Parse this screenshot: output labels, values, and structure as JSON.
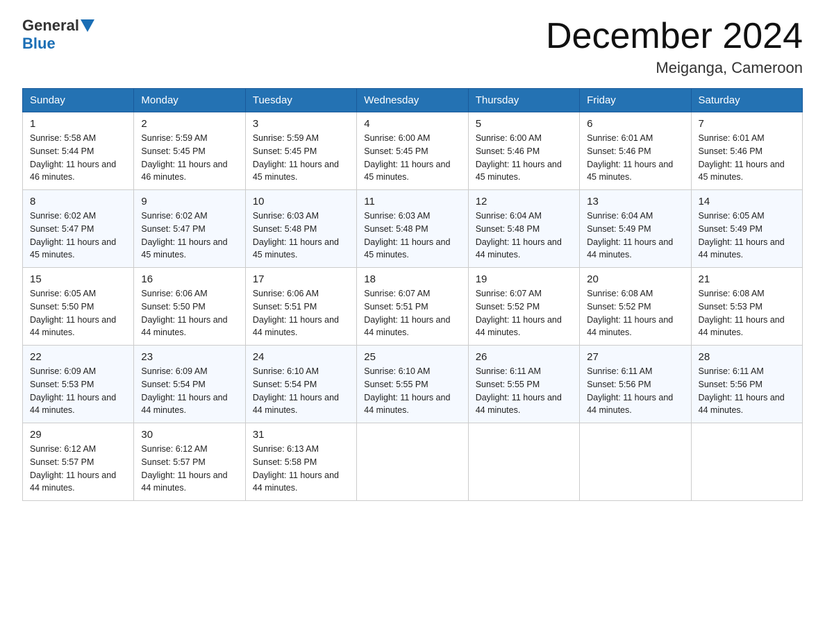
{
  "header": {
    "logo_general": "General",
    "logo_blue": "Blue",
    "title": "December 2024",
    "location": "Meiganga, Cameroon"
  },
  "days_of_week": [
    "Sunday",
    "Monday",
    "Tuesday",
    "Wednesday",
    "Thursday",
    "Friday",
    "Saturday"
  ],
  "weeks": [
    [
      {
        "num": "1",
        "sunrise": "Sunrise: 5:58 AM",
        "sunset": "Sunset: 5:44 PM",
        "daylight": "Daylight: 11 hours and 46 minutes."
      },
      {
        "num": "2",
        "sunrise": "Sunrise: 5:59 AM",
        "sunset": "Sunset: 5:45 PM",
        "daylight": "Daylight: 11 hours and 46 minutes."
      },
      {
        "num": "3",
        "sunrise": "Sunrise: 5:59 AM",
        "sunset": "Sunset: 5:45 PM",
        "daylight": "Daylight: 11 hours and 45 minutes."
      },
      {
        "num": "4",
        "sunrise": "Sunrise: 6:00 AM",
        "sunset": "Sunset: 5:45 PM",
        "daylight": "Daylight: 11 hours and 45 minutes."
      },
      {
        "num": "5",
        "sunrise": "Sunrise: 6:00 AM",
        "sunset": "Sunset: 5:46 PM",
        "daylight": "Daylight: 11 hours and 45 minutes."
      },
      {
        "num": "6",
        "sunrise": "Sunrise: 6:01 AM",
        "sunset": "Sunset: 5:46 PM",
        "daylight": "Daylight: 11 hours and 45 minutes."
      },
      {
        "num": "7",
        "sunrise": "Sunrise: 6:01 AM",
        "sunset": "Sunset: 5:46 PM",
        "daylight": "Daylight: 11 hours and 45 minutes."
      }
    ],
    [
      {
        "num": "8",
        "sunrise": "Sunrise: 6:02 AM",
        "sunset": "Sunset: 5:47 PM",
        "daylight": "Daylight: 11 hours and 45 minutes."
      },
      {
        "num": "9",
        "sunrise": "Sunrise: 6:02 AM",
        "sunset": "Sunset: 5:47 PM",
        "daylight": "Daylight: 11 hours and 45 minutes."
      },
      {
        "num": "10",
        "sunrise": "Sunrise: 6:03 AM",
        "sunset": "Sunset: 5:48 PM",
        "daylight": "Daylight: 11 hours and 45 minutes."
      },
      {
        "num": "11",
        "sunrise": "Sunrise: 6:03 AM",
        "sunset": "Sunset: 5:48 PM",
        "daylight": "Daylight: 11 hours and 45 minutes."
      },
      {
        "num": "12",
        "sunrise": "Sunrise: 6:04 AM",
        "sunset": "Sunset: 5:48 PM",
        "daylight": "Daylight: 11 hours and 44 minutes."
      },
      {
        "num": "13",
        "sunrise": "Sunrise: 6:04 AM",
        "sunset": "Sunset: 5:49 PM",
        "daylight": "Daylight: 11 hours and 44 minutes."
      },
      {
        "num": "14",
        "sunrise": "Sunrise: 6:05 AM",
        "sunset": "Sunset: 5:49 PM",
        "daylight": "Daylight: 11 hours and 44 minutes."
      }
    ],
    [
      {
        "num": "15",
        "sunrise": "Sunrise: 6:05 AM",
        "sunset": "Sunset: 5:50 PM",
        "daylight": "Daylight: 11 hours and 44 minutes."
      },
      {
        "num": "16",
        "sunrise": "Sunrise: 6:06 AM",
        "sunset": "Sunset: 5:50 PM",
        "daylight": "Daylight: 11 hours and 44 minutes."
      },
      {
        "num": "17",
        "sunrise": "Sunrise: 6:06 AM",
        "sunset": "Sunset: 5:51 PM",
        "daylight": "Daylight: 11 hours and 44 minutes."
      },
      {
        "num": "18",
        "sunrise": "Sunrise: 6:07 AM",
        "sunset": "Sunset: 5:51 PM",
        "daylight": "Daylight: 11 hours and 44 minutes."
      },
      {
        "num": "19",
        "sunrise": "Sunrise: 6:07 AM",
        "sunset": "Sunset: 5:52 PM",
        "daylight": "Daylight: 11 hours and 44 minutes."
      },
      {
        "num": "20",
        "sunrise": "Sunrise: 6:08 AM",
        "sunset": "Sunset: 5:52 PM",
        "daylight": "Daylight: 11 hours and 44 minutes."
      },
      {
        "num": "21",
        "sunrise": "Sunrise: 6:08 AM",
        "sunset": "Sunset: 5:53 PM",
        "daylight": "Daylight: 11 hours and 44 minutes."
      }
    ],
    [
      {
        "num": "22",
        "sunrise": "Sunrise: 6:09 AM",
        "sunset": "Sunset: 5:53 PM",
        "daylight": "Daylight: 11 hours and 44 minutes."
      },
      {
        "num": "23",
        "sunrise": "Sunrise: 6:09 AM",
        "sunset": "Sunset: 5:54 PM",
        "daylight": "Daylight: 11 hours and 44 minutes."
      },
      {
        "num": "24",
        "sunrise": "Sunrise: 6:10 AM",
        "sunset": "Sunset: 5:54 PM",
        "daylight": "Daylight: 11 hours and 44 minutes."
      },
      {
        "num": "25",
        "sunrise": "Sunrise: 6:10 AM",
        "sunset": "Sunset: 5:55 PM",
        "daylight": "Daylight: 11 hours and 44 minutes."
      },
      {
        "num": "26",
        "sunrise": "Sunrise: 6:11 AM",
        "sunset": "Sunset: 5:55 PM",
        "daylight": "Daylight: 11 hours and 44 minutes."
      },
      {
        "num": "27",
        "sunrise": "Sunrise: 6:11 AM",
        "sunset": "Sunset: 5:56 PM",
        "daylight": "Daylight: 11 hours and 44 minutes."
      },
      {
        "num": "28",
        "sunrise": "Sunrise: 6:11 AM",
        "sunset": "Sunset: 5:56 PM",
        "daylight": "Daylight: 11 hours and 44 minutes."
      }
    ],
    [
      {
        "num": "29",
        "sunrise": "Sunrise: 6:12 AM",
        "sunset": "Sunset: 5:57 PM",
        "daylight": "Daylight: 11 hours and 44 minutes."
      },
      {
        "num": "30",
        "sunrise": "Sunrise: 6:12 AM",
        "sunset": "Sunset: 5:57 PM",
        "daylight": "Daylight: 11 hours and 44 minutes."
      },
      {
        "num": "31",
        "sunrise": "Sunrise: 6:13 AM",
        "sunset": "Sunset: 5:58 PM",
        "daylight": "Daylight: 11 hours and 44 minutes."
      },
      null,
      null,
      null,
      null
    ]
  ]
}
